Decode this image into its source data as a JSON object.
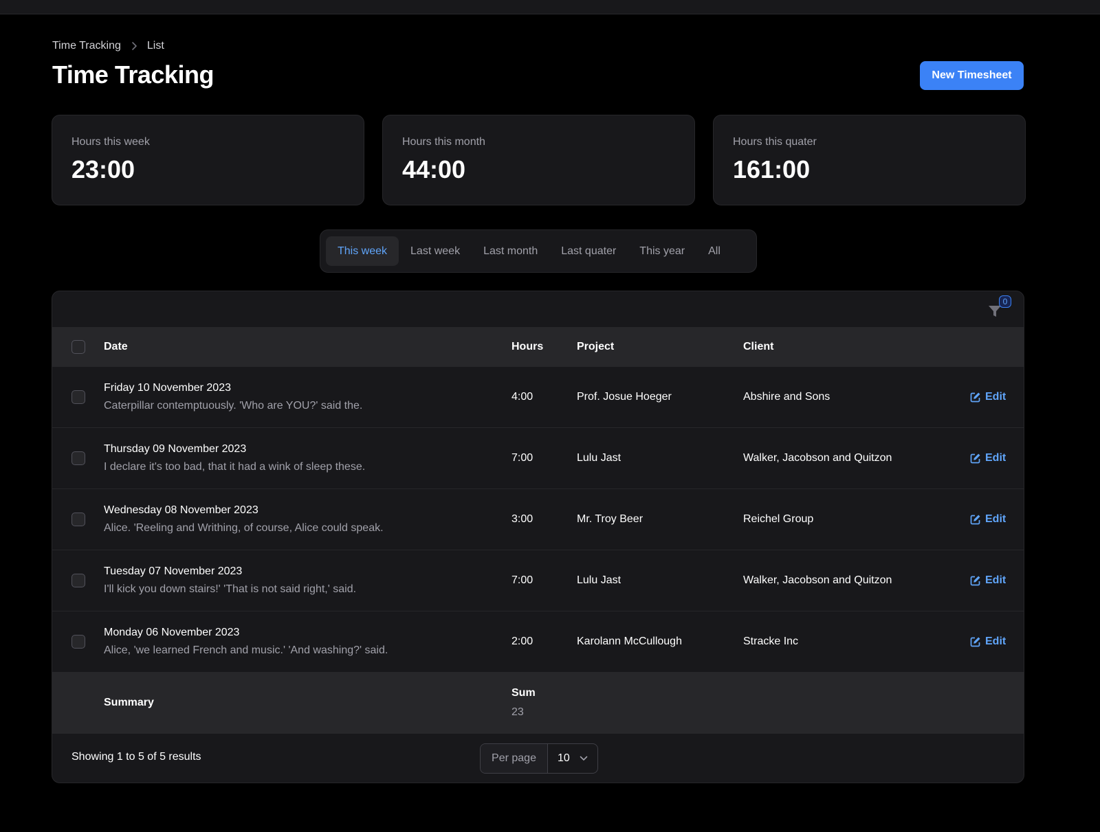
{
  "breadcrumb": {
    "items": [
      "Time Tracking",
      "List"
    ]
  },
  "header": {
    "title": "Time Tracking",
    "new_button": "New Timesheet"
  },
  "stats": [
    {
      "label": "Hours this week",
      "value": "23:00"
    },
    {
      "label": "Hours this month",
      "value": "44:00"
    },
    {
      "label": "Hours this quater",
      "value": "161:00"
    }
  ],
  "tabs": [
    {
      "label": "This week",
      "active": true
    },
    {
      "label": "Last week"
    },
    {
      "label": "Last month"
    },
    {
      "label": "Last quater"
    },
    {
      "label": "This year"
    },
    {
      "label": "All"
    }
  ],
  "filter": {
    "count": "0"
  },
  "table": {
    "columns": {
      "date": "Date",
      "hours": "Hours",
      "project": "Project",
      "client": "Client"
    },
    "rows": [
      {
        "date": "Friday 10 November 2023",
        "description": "Caterpillar contemptuously. 'Who are YOU?' said the.",
        "hours": "4:00",
        "project": "Prof. Josue Hoeger",
        "client": "Abshire and Sons",
        "action": "Edit"
      },
      {
        "date": "Thursday 09 November 2023",
        "description": "I declare it's too bad, that it had a wink of sleep these.",
        "hours": "7:00",
        "project": "Lulu Jast",
        "client": "Walker, Jacobson and Quitzon",
        "action": "Edit"
      },
      {
        "date": "Wednesday 08 November 2023",
        "description": "Alice. 'Reeling and Writhing, of course, Alice could speak.",
        "hours": "3:00",
        "project": "Mr. Troy Beer",
        "client": "Reichel Group",
        "action": "Edit"
      },
      {
        "date": "Tuesday 07 November 2023",
        "description": "I'll kick you down stairs!' 'That is not said right,' said.",
        "hours": "7:00",
        "project": "Lulu Jast",
        "client": "Walker, Jacobson and Quitzon",
        "action": "Edit"
      },
      {
        "date": "Monday 06 November 2023",
        "description": "Alice, 'we learned French and music.' 'And washing?' said.",
        "hours": "2:00",
        "project": "Karolann McCullough",
        "client": "Stracke Inc",
        "action": "Edit"
      }
    ],
    "summary": {
      "label": "Summary",
      "sum_label": "Sum",
      "sum_value": "23"
    }
  },
  "pagination": {
    "results": "Showing 1 to 5 of 5 results",
    "per_page_label": "Per page",
    "per_page_value": "10"
  },
  "colors": {
    "accent": "#3b82f6",
    "link": "#60a5fa",
    "card": "#18181b",
    "background": "#000000"
  },
  "icons": {
    "breadcrumb_sep": "chevron-right-icon",
    "filter": "funnel-icon",
    "edit": "pencil-square-icon",
    "select": "chevron-down-icon"
  }
}
